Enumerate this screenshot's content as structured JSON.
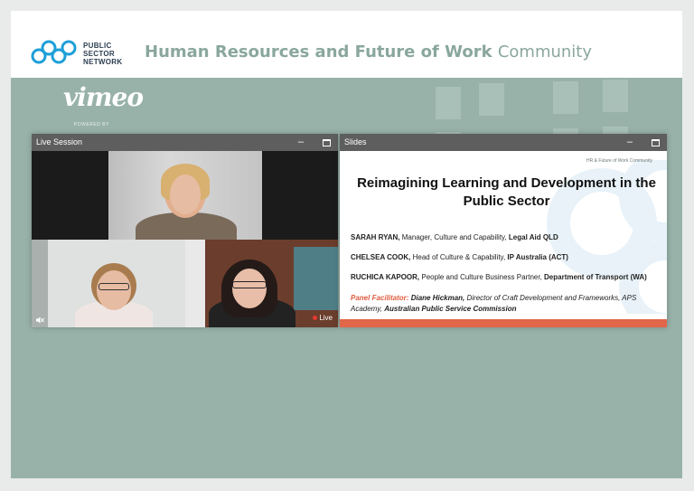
{
  "header": {
    "logo_lines": [
      "PUBLIC",
      "SECTOR",
      "NETWORK"
    ],
    "title_bold": "Human Resources and Future of Work",
    "title_light": "Community"
  },
  "vimeo": {
    "logo": "vimeo",
    "sub": "POWERED BY"
  },
  "live_panel": {
    "title": "Live Session",
    "live_label": "Live"
  },
  "slides_panel": {
    "title": "Slides",
    "brand": "HR & Future of Work Community",
    "slide_title": "Reimagining Learning and Development in the Public Sector",
    "speakers": [
      {
        "name": "SARAH RYAN,",
        "role": " Manager, Culture and Capability, ",
        "org": "Legal Aid QLD"
      },
      {
        "name": "CHELSEA COOK,",
        "role": " Head of Culture & Capability, ",
        "org": "IP Australia (ACT)"
      },
      {
        "name": "RUCHICA KAPOOR,",
        "role": " People and Culture Business Partner, ",
        "org": "Department of Transport (WA)"
      }
    ],
    "facilitator": {
      "label": "Panel Facilitator:",
      "name": "Diane Hickman,",
      "role": " Director of Craft Development and Frameworks, APS Academy, ",
      "org": "Australian Public Service Commission"
    }
  },
  "colors": {
    "background": "#98b2a9",
    "accent_blue": "#1d9fd8",
    "facilitator_red": "#e05a3f"
  },
  "icons": {
    "minimize": "minimize-icon",
    "maximize": "maximize-icon",
    "muted": "muted-speaker-icon"
  }
}
